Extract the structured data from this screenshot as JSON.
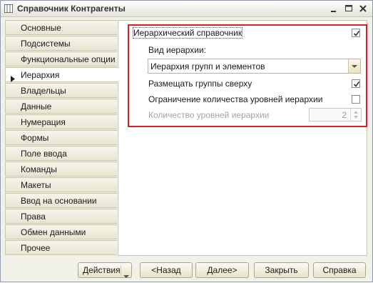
{
  "window": {
    "title": "Справочник Контрагенты"
  },
  "nav": {
    "items": [
      {
        "label": "Основные"
      },
      {
        "label": "Подсистемы"
      },
      {
        "label": "Функциональные опции"
      },
      {
        "label": "Иерархия"
      },
      {
        "label": "Владельцы"
      },
      {
        "label": "Данные"
      },
      {
        "label": "Нумерация"
      },
      {
        "label": "Формы"
      },
      {
        "label": "Поле ввода"
      },
      {
        "label": "Команды"
      },
      {
        "label": "Макеты"
      },
      {
        "label": "Ввод на основании"
      },
      {
        "label": "Права"
      },
      {
        "label": "Обмен данными"
      },
      {
        "label": "Прочее"
      }
    ],
    "active": "Иерархия"
  },
  "hierarchy": {
    "hierarchical_label": "Иерархический справочник",
    "hierarchical_checked": true,
    "type_label": "Вид иерархии:",
    "type_value": "Иерархия групп и элементов",
    "groups_on_top_label": "Размещать группы сверху",
    "groups_on_top_checked": true,
    "limit_levels_label": "Ограничение количества уровней иерархии",
    "limit_levels_checked": false,
    "levels_count_label": "Количество уровней иерархии",
    "levels_count_value": "2"
  },
  "footer": {
    "actions_label": "Действия",
    "back_label": "<Назад",
    "next_label": "Далее>",
    "close_label": "Закрыть",
    "help_label": "Справка"
  },
  "colors": {
    "highlight": "#d22227",
    "accent_check": "#333333"
  }
}
